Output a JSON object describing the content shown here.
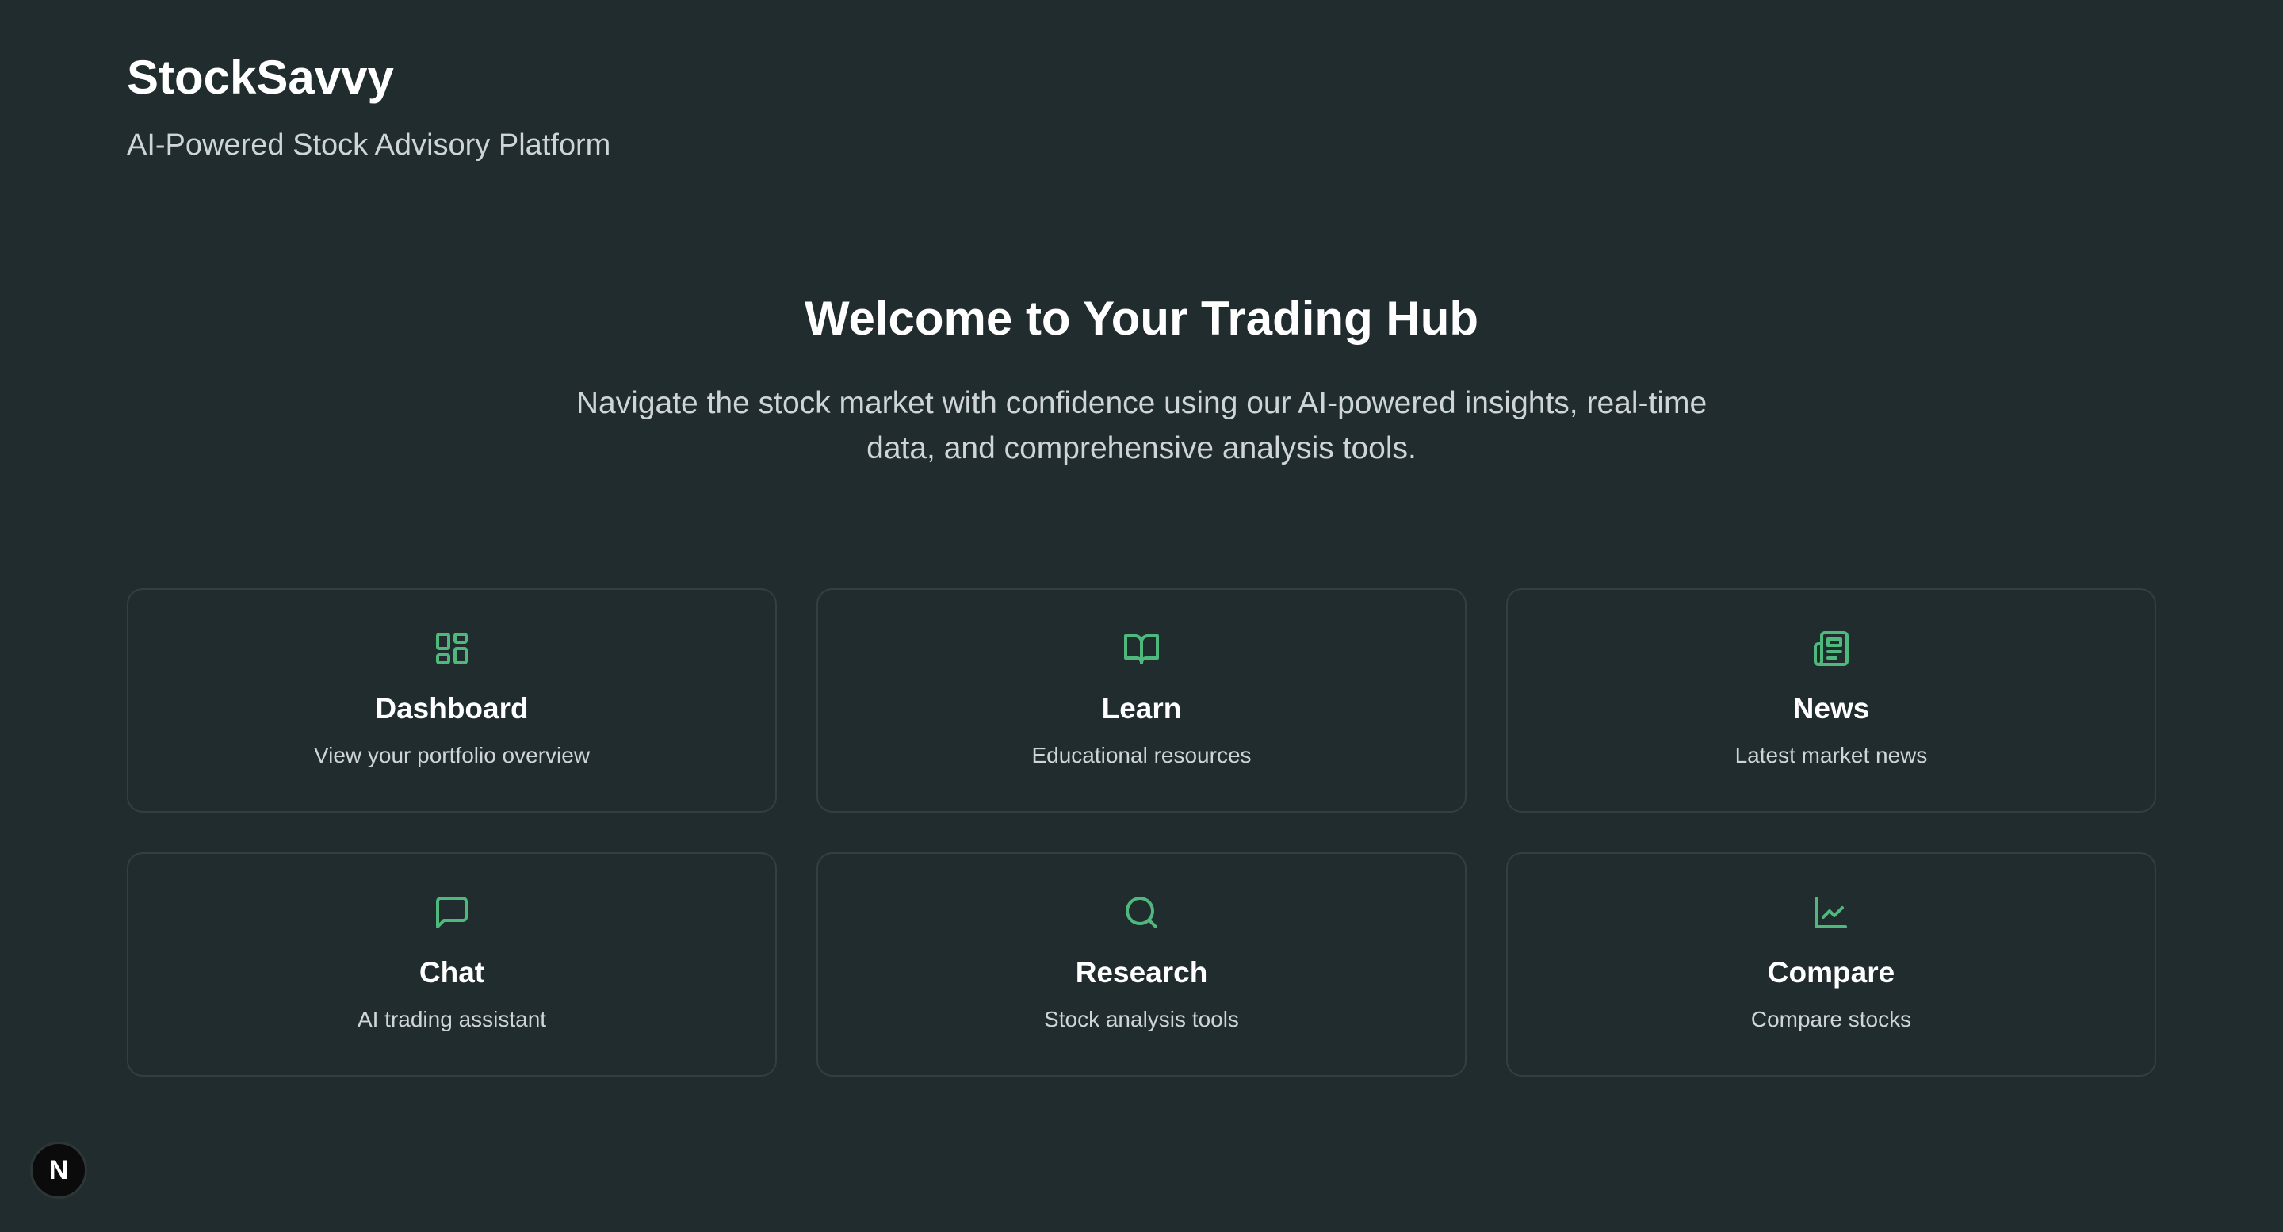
{
  "header": {
    "brand": "StockSavvy",
    "tagline": "AI-Powered Stock Advisory Platform"
  },
  "hero": {
    "title": "Welcome to Your Trading Hub",
    "subtitle": "Navigate the stock market with confidence using our AI-powered insights, real-time data, and comprehensive analysis tools."
  },
  "cards": [
    {
      "title": "Dashboard",
      "description": "View your portfolio overview",
      "icon": "dashboard-icon"
    },
    {
      "title": "Learn",
      "description": "Educational resources",
      "icon": "book-icon"
    },
    {
      "title": "News",
      "description": "Latest market news",
      "icon": "newspaper-icon"
    },
    {
      "title": "Chat",
      "description": "AI trading assistant",
      "icon": "message-icon"
    },
    {
      "title": "Research",
      "description": "Stock analysis tools",
      "icon": "search-icon"
    },
    {
      "title": "Compare",
      "description": "Compare stocks",
      "icon": "line-chart-icon"
    }
  ],
  "badge": {
    "letter": "N",
    "icon": "nextjs-logo-icon"
  },
  "colors": {
    "background": "#212c2f",
    "accent": "#4fb87c",
    "card_border": "#33403f",
    "muted_text": "#cfd5d6"
  }
}
